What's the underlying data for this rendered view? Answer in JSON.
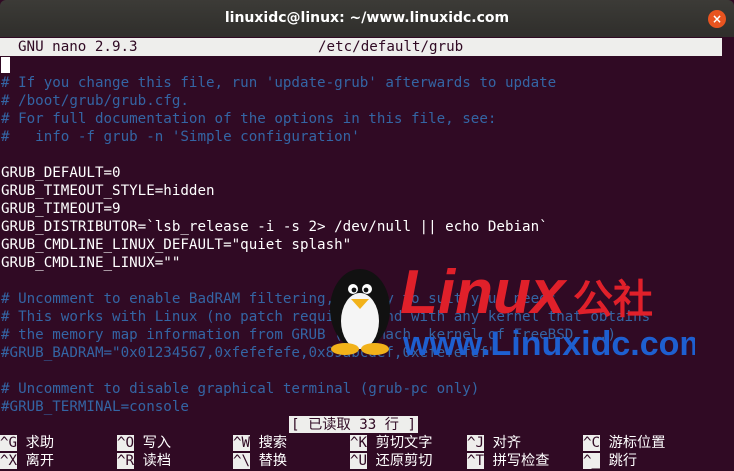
{
  "window": {
    "title": "linuxidc@linux: ~/www.linuxidc.com",
    "close_icon": "×"
  },
  "nano": {
    "version": "GNU nano 2.9.3",
    "filename": "/etc/default/grub"
  },
  "lines": [
    "",
    "# If you change this file, run 'update-grub' afterwards to update",
    "# /boot/grub/grub.cfg.",
    "# For full documentation of the options in this file, see:",
    "#   info -f grub -n 'Simple configuration'",
    "",
    "GRUB_DEFAULT=0",
    "GRUB_TIMEOUT_STYLE=hidden",
    "GRUB_TIMEOUT=9",
    "GRUB_DISTRIBUTOR=`lsb_release -i -s 2> /dev/null || echo Debian`",
    "GRUB_CMDLINE_LINUX_DEFAULT=\"quiet splash\"",
    "GRUB_CMDLINE_LINUX=\"\"",
    "",
    "# Uncomment to enable BadRAM filtering, modify to suit your needs",
    "# This works with Linux (no patch required) and with any kernel that obtains",
    "# the memory map information from GRUB (GNU Mach, kernel of FreeBSD ...)",
    "#GRUB_BADRAM=\"0x01234567,0xfefefefe,0x89abcdef,0xefefefef\"",
    "",
    "# Uncomment to disable graphical terminal (grub-pc only)",
    "#GRUB_TERMINAL=console"
  ],
  "status_message": "[ 已读取 33 行 ]",
  "shortcuts_row1": [
    {
      "key": "^G",
      "label": "求助"
    },
    {
      "key": "^O",
      "label": "写入"
    },
    {
      "key": "^W",
      "label": "搜索"
    },
    {
      "key": "^K",
      "label": "剪切文字"
    },
    {
      "key": "^J",
      "label": "对齐"
    },
    {
      "key": "^C",
      "label": "游标位置"
    }
  ],
  "shortcuts_row2": [
    {
      "key": "^X",
      "label": "离开"
    },
    {
      "key": "^R",
      "label": "读档"
    },
    {
      "key": "^\\",
      "label": "替换"
    },
    {
      "key": "^U",
      "label": "还原剪切"
    },
    {
      "key": "^T",
      "label": "拼写检查"
    },
    {
      "key": "^_",
      "label": "跳行"
    }
  ],
  "watermark": {
    "brand": "Linux",
    "suffix": "公社",
    "url": "www.Linuxidc.com"
  },
  "colors": {
    "terminal_bg": "#300a24",
    "comment": "#3465a4",
    "watermark_red": "#e0202a",
    "watermark_blue": "#1e5fd0"
  }
}
